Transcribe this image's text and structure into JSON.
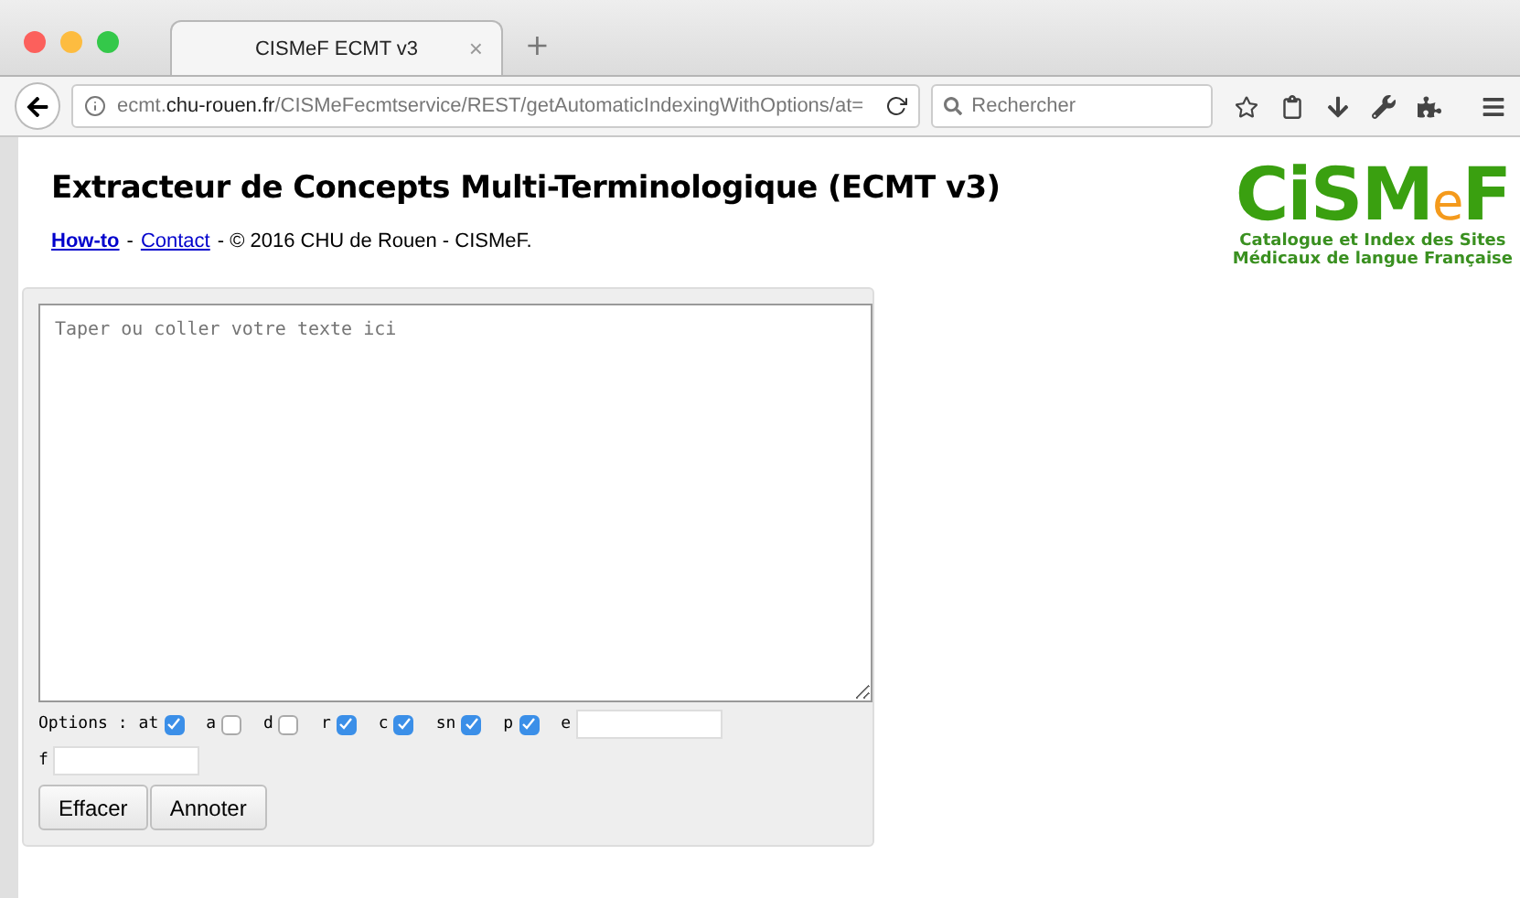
{
  "browser": {
    "tab": {
      "title": "CISMeF ECMT v3",
      "close": "×",
      "new_tab": "+"
    },
    "url": {
      "host_prefix": "ecmt.",
      "host": "chu-rouen.fr",
      "path": "/CISMeFecmtservice/REST/getAutomaticIndexingWithOptions/at="
    },
    "search": {
      "placeholder": "Rechercher"
    }
  },
  "page": {
    "title": "Extracteur de Concepts Multi-Terminologique (ECMT v3)",
    "links": [
      {
        "kind": "bold",
        "label": "How-to"
      },
      {
        "kind": "plain",
        "label": "Contact"
      }
    ],
    "separator": "-",
    "footer_text": "- © 2016 CHU de Rouen - CISMeF.",
    "logo": {
      "letters": [
        {
          "text": "CiSM",
          "kind": "main"
        },
        {
          "text": "e",
          "kind": "accent"
        },
        {
          "text": "F",
          "kind": "main"
        }
      ],
      "tagline": [
        "Catalogue et Index des Sites",
        "Médicaux de langue Française"
      ]
    },
    "form": {
      "placeholder": "Taper ou coller votre texte ici",
      "options_label": "Options :",
      "options": [
        {
          "kind": "checkbox",
          "label": "at",
          "checked": true
        },
        {
          "kind": "checkbox",
          "label": "a",
          "checked": false
        },
        {
          "kind": "checkbox",
          "label": "d",
          "checked": false
        },
        {
          "kind": "checkbox",
          "label": "r",
          "checked": true
        },
        {
          "kind": "checkbox",
          "label": "c",
          "checked": true
        },
        {
          "kind": "checkbox",
          "label": "sn",
          "checked": true
        },
        {
          "kind": "checkbox",
          "label": "p",
          "checked": true
        },
        {
          "kind": "text",
          "label": "e"
        },
        {
          "kind": "text",
          "label": "f"
        }
      ],
      "buttons": [
        "Effacer",
        "Annoter"
      ]
    }
  }
}
